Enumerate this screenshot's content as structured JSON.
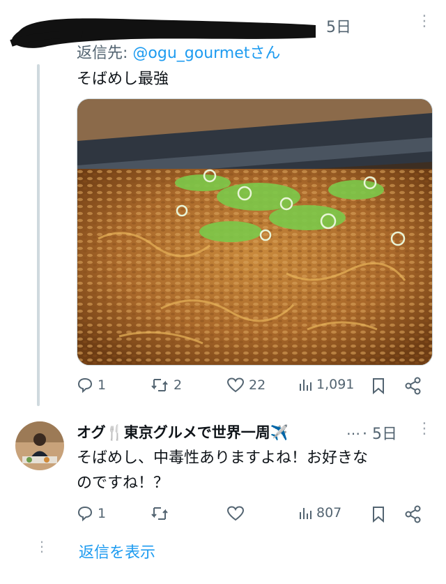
{
  "tweet1": {
    "timestamp": "5日",
    "reply_to_label": "返信先: ",
    "reply_to_handle": "@ogu_gourmet",
    "reply_to_suffix": "さん",
    "text": "そばめし最強",
    "media_icon": "photo-fried-rice-noodles",
    "actions": {
      "reply": "1",
      "retweet": "2",
      "like": "22",
      "views": "1,091"
    }
  },
  "tweet2": {
    "author_name": "オグ🍴東京グルメで世界一周✈️",
    "ellipsis": "…",
    "timestamp": "· 5日",
    "text_line1": "そばめし、中毒性ありますよね！お好きな",
    "text_line2": "のですね！？",
    "actions": {
      "reply": "1",
      "retweet": "",
      "like": "",
      "views": "807"
    }
  },
  "show_replies": "返信を表示",
  "colors": {
    "accent": "#1d9bf0",
    "muted": "#536471",
    "text": "#0f1419",
    "line": "#cfd9de"
  }
}
